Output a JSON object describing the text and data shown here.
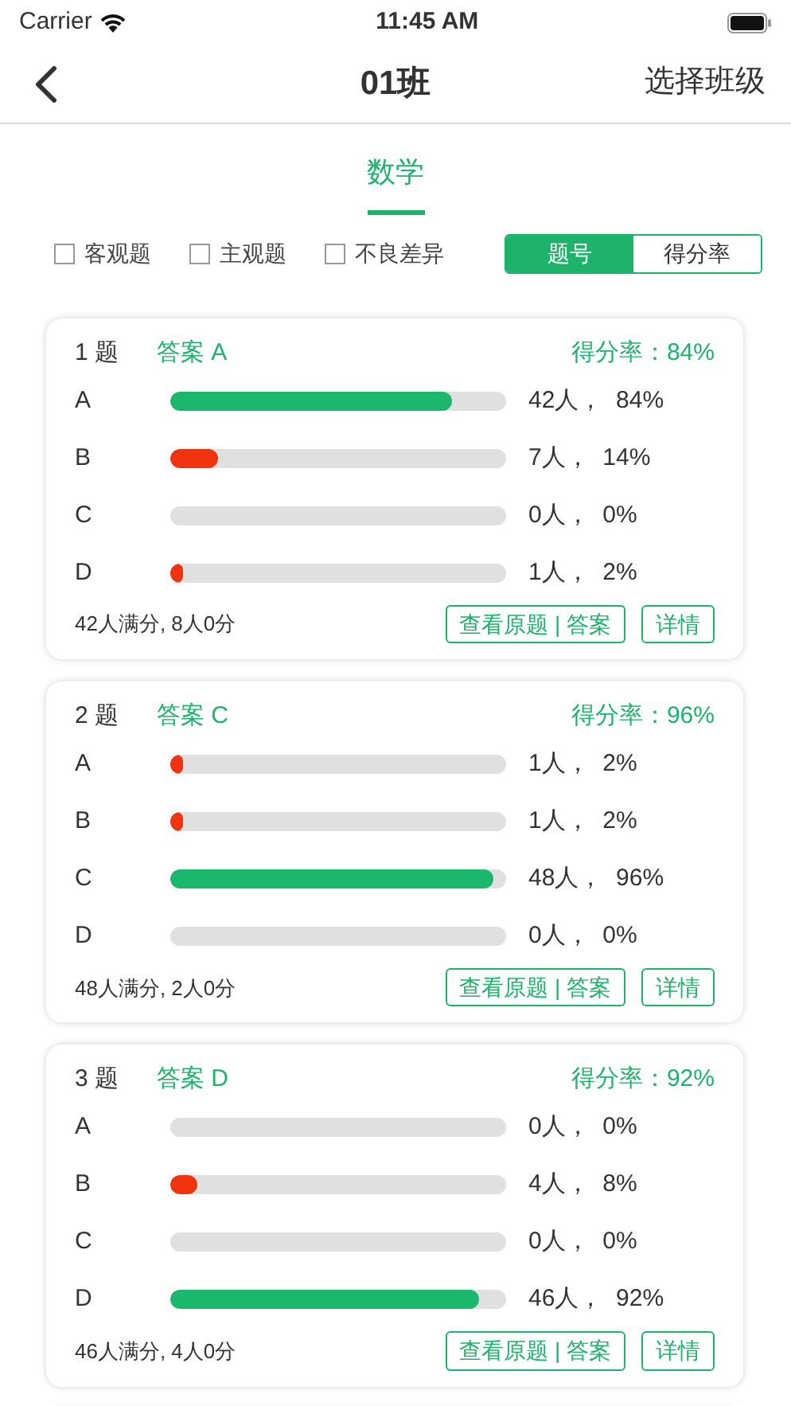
{
  "status_bar": {
    "carrier": "Carrier",
    "time": "11:45 AM"
  },
  "nav": {
    "title": "01班",
    "action": "选择班级"
  },
  "subject_tabs": [
    {
      "label": "数学",
      "selected": true
    }
  ],
  "filters": [
    {
      "label": "客观题",
      "checked": false
    },
    {
      "label": "主观题",
      "checked": false
    },
    {
      "label": "不良差异",
      "checked": false
    }
  ],
  "sort_toggle": [
    {
      "label": "题号",
      "selected": true
    },
    {
      "label": "得分率",
      "selected": false
    }
  ],
  "questions": [
    {
      "number": "1 题",
      "answer": "答案 A",
      "rate": "得分率：84%",
      "options": [
        {
          "letter": "A",
          "correct": true,
          "level": 0.84,
          "reading": "42人，  84%"
        },
        {
          "letter": "B",
          "correct": false,
          "level": 0.14,
          "reading": "7人，  14%"
        },
        {
          "letter": "C",
          "level": 0,
          "reading": "0人，  0%"
        },
        {
          "letter": "D",
          "correct": false,
          "level": 0.02,
          "reading": "1人，  2%"
        }
      ],
      "summary": "42人满分, 8人0分",
      "buttons": [
        "查看原题 | 答案",
        "详情"
      ]
    },
    {
      "number": "2 题",
      "answer": "答案 C",
      "rate": "得分率：96%",
      "options": [
        {
          "letter": "A",
          "correct": false,
          "level": 0.02,
          "reading": "1人，  2%"
        },
        {
          "letter": "B",
          "correct": false,
          "level": 0.02,
          "reading": "1人，  2%"
        },
        {
          "letter": "C",
          "correct": true,
          "level": 0.96,
          "reading": "48人，  96%"
        },
        {
          "letter": "D",
          "level": 0,
          "reading": "0人，  0%"
        }
      ],
      "summary": "48人满分, 2人0分",
      "buttons": [
        "查看原题 | 答案",
        "详情"
      ]
    },
    {
      "number": "3 题",
      "answer": "答案 D",
      "rate": "得分率：92%",
      "options": [
        {
          "letter": "A",
          "level": 0,
          "reading": "0人，  0%"
        },
        {
          "letter": "B",
          "correct": false,
          "level": 0.08,
          "reading": "4人，  8%"
        },
        {
          "letter": "C",
          "level": 0,
          "reading": "0人，  0%"
        },
        {
          "letter": "D",
          "correct": true,
          "level": 0.92,
          "reading": "46人，  92%"
        }
      ],
      "summary": "46人满分, 4人0分",
      "buttons": [
        "查看原题 | 答案",
        "详情"
      ]
    }
  ]
}
